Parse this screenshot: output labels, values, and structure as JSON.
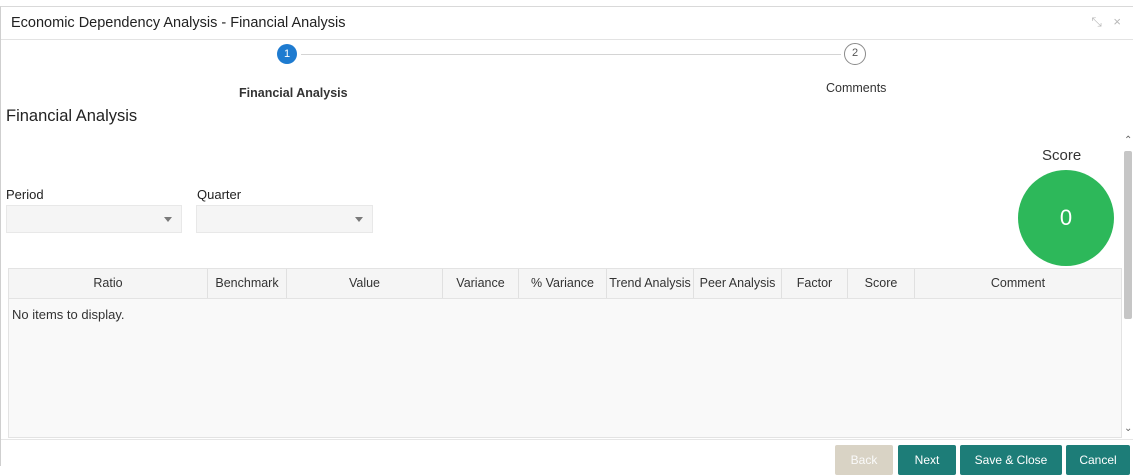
{
  "window": {
    "title": "Economic Dependency Analysis - Financial Analysis",
    "minimize_glyph": "⤡",
    "close_glyph": "×"
  },
  "stepper": {
    "steps": [
      {
        "number": "1",
        "label": "Financial Analysis",
        "state": "active"
      },
      {
        "number": "2",
        "label": "Comments",
        "state": "inactive"
      }
    ]
  },
  "section": {
    "title": "Financial Analysis"
  },
  "filters": {
    "period_label": "Period",
    "period_value": "",
    "quarter_label": "Quarter",
    "quarter_value": ""
  },
  "score": {
    "label": "Score",
    "value": "0"
  },
  "table": {
    "columns": [
      "Ratio",
      "Benchmark",
      "Value",
      "Variance",
      "% Variance",
      "Trend Analysis",
      "Peer Analysis",
      "Factor",
      "Score",
      "Comment"
    ],
    "empty_message": "No items to display."
  },
  "footer": {
    "back_label": "Back",
    "next_label": "Next",
    "save_close_label": "Save & Close",
    "cancel_label": "Cancel"
  },
  "colors": {
    "accent_blue": "#1e7bd0",
    "score_green": "#2db85a",
    "button_teal": "#1d7d78",
    "button_disabled": "#d9d3c5"
  }
}
